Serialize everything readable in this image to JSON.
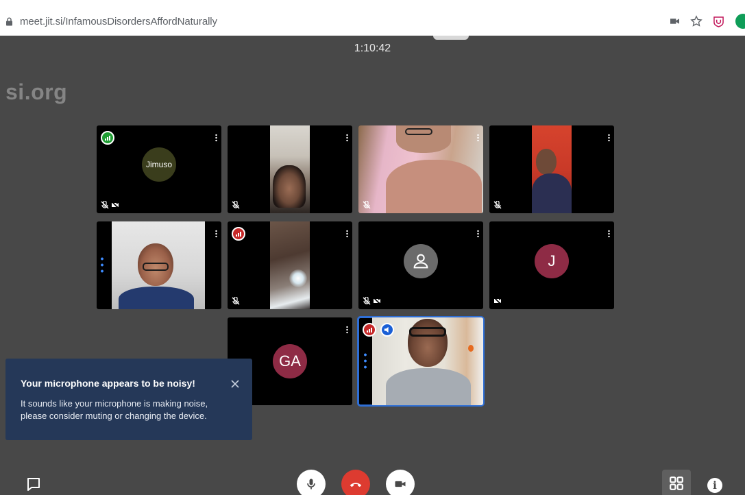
{
  "browser": {
    "url": "meet.jit.si/InfamousDisordersAffordNaturally",
    "icons": [
      "lock-icon",
      "camera-icon",
      "star-icon",
      "extension-shield-icon",
      "profile-avatar-icon"
    ]
  },
  "meeting": {
    "timer": "1:10:42",
    "watermark": "si.org"
  },
  "tiles": [
    {
      "id": "jimuso",
      "avatar_text": "Jimuso",
      "status": "muted, camera off",
      "connection": "good"
    },
    {
      "id": "participant-2",
      "status": "muted"
    },
    {
      "id": "participant-3",
      "status": "muted"
    },
    {
      "id": "participant-4",
      "status": "muted"
    },
    {
      "id": "participant-5",
      "status": ""
    },
    {
      "id": "participant-6",
      "status": "muted",
      "connection": "poor"
    },
    {
      "id": "participant-7",
      "status": "muted, camera off"
    },
    {
      "id": "participant-j",
      "avatar_text": "J",
      "status": "camera off"
    },
    {
      "id": "participant-ga",
      "avatar_text": "GA"
    },
    {
      "id": "local",
      "status": "speaking",
      "connection": "poor"
    }
  ],
  "notification": {
    "title": "Your microphone appears to be noisy!",
    "message": "It sounds like your microphone is making noise, please consider muting or changing the device."
  },
  "colors": {
    "stage": "#484848",
    "toast": "#253858",
    "hangup": "#dd3b30",
    "selected": "#2f6fd6"
  }
}
